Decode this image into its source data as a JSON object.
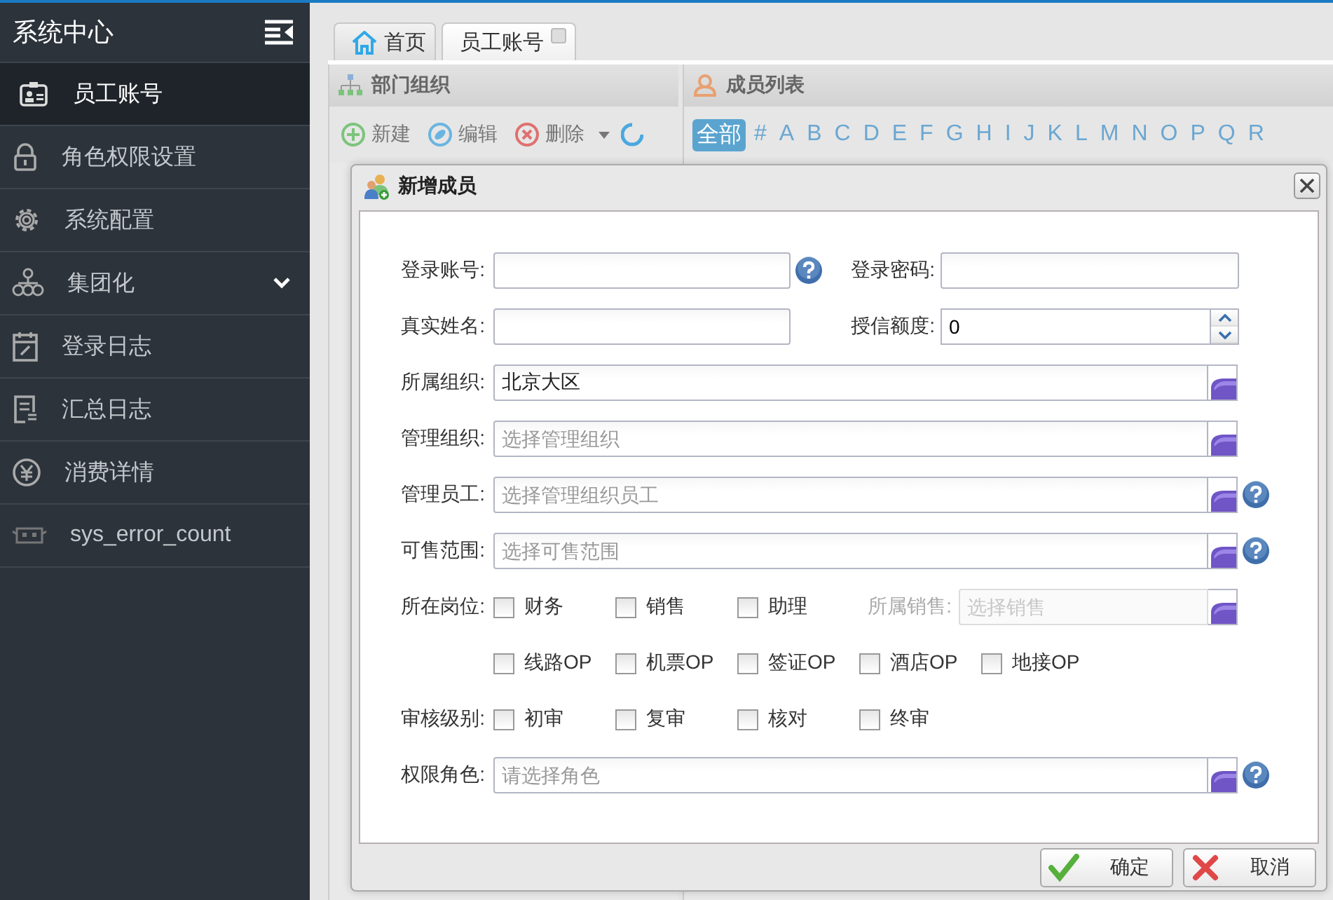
{
  "sidebar": {
    "title": "系统中心",
    "items": [
      {
        "label": "员工账号",
        "selected": true,
        "expandable": false
      },
      {
        "label": "角色权限设置",
        "selected": false,
        "expandable": false
      },
      {
        "label": "系统配置",
        "selected": false,
        "expandable": false
      },
      {
        "label": "集团化",
        "selected": false,
        "expandable": true
      },
      {
        "label": "登录日志",
        "selected": false,
        "expandable": false
      },
      {
        "label": "汇总日志",
        "selected": false,
        "expandable": false
      },
      {
        "label": "消费详情",
        "selected": false,
        "expandable": false
      },
      {
        "label": "sys_error_count",
        "selected": false,
        "expandable": false
      }
    ]
  },
  "tabs": [
    {
      "label": "首页",
      "selected": false,
      "closable": false
    },
    {
      "label": "员工账号",
      "selected": true,
      "closable": true
    }
  ],
  "dept_panel": {
    "title": "部门组织",
    "toolbar": [
      "新建",
      "编辑",
      "删除"
    ]
  },
  "member_panel": {
    "title": "成员列表",
    "letters": [
      {
        "label": "全部",
        "selected": true
      },
      {
        "label": "#",
        "selected": false
      },
      {
        "label": "A",
        "selected": false
      },
      {
        "label": "B",
        "selected": false
      },
      {
        "label": "C",
        "selected": false
      },
      {
        "label": "D",
        "selected": false
      },
      {
        "label": "E",
        "selected": false
      },
      {
        "label": "F",
        "selected": false
      },
      {
        "label": "G",
        "selected": false
      },
      {
        "label": "H",
        "selected": false
      },
      {
        "label": "I",
        "selected": false
      },
      {
        "label": "J",
        "selected": false
      },
      {
        "label": "K",
        "selected": false
      },
      {
        "label": "L",
        "selected": false
      },
      {
        "label": "M",
        "selected": false
      },
      {
        "label": "N",
        "selected": false
      },
      {
        "label": "O",
        "selected": false
      },
      {
        "label": "P",
        "selected": false
      },
      {
        "label": "Q",
        "selected": false
      },
      {
        "label": "R",
        "selected": false
      }
    ]
  },
  "dialog": {
    "title": "新增成员",
    "rows": [
      {
        "kind": "pair",
        "fields": [
          {
            "label": "登录账号:",
            "kind": "text",
            "help": true
          },
          {
            "label": "登录密码:",
            "kind": "text",
            "help": false
          }
        ]
      },
      {
        "kind": "pair",
        "fields": [
          {
            "label": "真实姓名:",
            "kind": "text",
            "help": false
          },
          {
            "label": "授信额度:",
            "kind": "number",
            "value": "0",
            "help": false
          }
        ]
      },
      {
        "kind": "picker",
        "label": "所属组织:",
        "value": "北京大区",
        "help": false
      },
      {
        "kind": "picker",
        "label": "管理组织:",
        "placeholder": "选择管理组织",
        "help": false
      },
      {
        "kind": "picker",
        "label": "管理员工:",
        "placeholder": "选择管理组织员工",
        "help": true
      },
      {
        "kind": "picker",
        "label": "可售范围:",
        "placeholder": "选择可售范围",
        "help": true
      },
      {
        "kind": "checks",
        "label": "所在岗位:",
        "options": [
          {
            "label": "财务",
            "checked": false
          },
          {
            "label": "销售",
            "checked": false
          },
          {
            "label": "助理",
            "checked": false
          }
        ],
        "extra": {
          "label": "所属销售:",
          "placeholder": "选择销售",
          "disabled": true
        }
      },
      {
        "kind": "checks",
        "options": [
          {
            "label": "线路OP",
            "checked": false
          },
          {
            "label": "机票OP",
            "checked": false
          },
          {
            "label": "签证OP",
            "checked": false
          },
          {
            "label": "酒店OP",
            "checked": false
          },
          {
            "label": "地接OP",
            "checked": false
          }
        ]
      },
      {
        "kind": "checks",
        "label": "审核级别:",
        "options": [
          {
            "label": "初审",
            "checked": false
          },
          {
            "label": "复审",
            "checked": false
          },
          {
            "label": "核对",
            "checked": false
          },
          {
            "label": "终审",
            "checked": false
          }
        ]
      },
      {
        "kind": "picker",
        "label": "权限角色:",
        "placeholder": "请选择角色",
        "help": true
      }
    ],
    "buttons": [
      {
        "label": "确定",
        "kind": "ok"
      },
      {
        "label": "取消",
        "kind": "cancel"
      }
    ]
  }
}
